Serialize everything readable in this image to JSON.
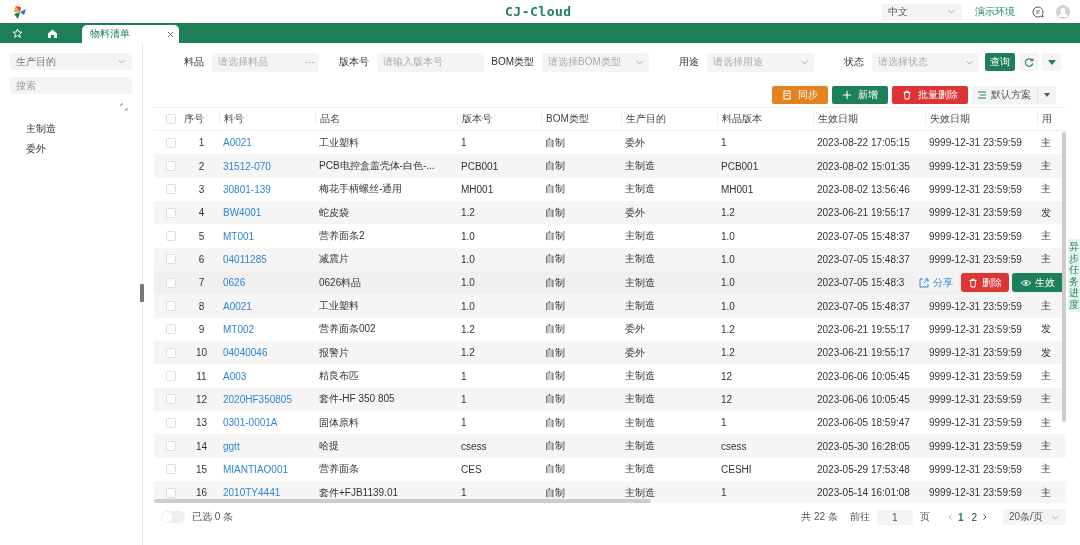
{
  "header": {
    "logo_text": "CJ-Cloud",
    "language": "中文",
    "environment": "演示环境"
  },
  "tabs": [
    {
      "label": "物料清单",
      "selected": true,
      "closable": true
    }
  ],
  "sidebar": {
    "purpose_select": {
      "placeholder": "生产目的"
    },
    "search": {
      "placeholder": "搜索"
    },
    "tree": [
      {
        "label": "主制造"
      },
      {
        "label": "委外"
      }
    ]
  },
  "filters": [
    {
      "label": "料品",
      "kind": "picker",
      "placeholder": "请选择料品"
    },
    {
      "label": "版本号",
      "kind": "input",
      "placeholder": "请输入版本号"
    },
    {
      "label": "BOM类型",
      "kind": "select",
      "placeholder": "请选择BOM类型"
    },
    {
      "label": "用途",
      "kind": "select",
      "placeholder": "请选择用途"
    },
    {
      "label": "状态",
      "kind": "select",
      "placeholder": "请选择状态"
    }
  ],
  "query_button": "查询",
  "toolbar": [
    {
      "label": "同步",
      "kind": "sync"
    },
    {
      "label": "新增",
      "kind": "add"
    },
    {
      "label": "批量删除",
      "kind": "delete"
    }
  ],
  "scheme": {
    "label": "默认方案"
  },
  "table": {
    "header_checked": false,
    "columns": [
      {
        "label": "序号",
        "kind": "index"
      },
      {
        "label": "料号",
        "kind": "link"
      },
      {
        "label": "品名",
        "kind": "text"
      },
      {
        "label": "版本号",
        "kind": "text"
      },
      {
        "label": "BOM类型",
        "kind": "text"
      },
      {
        "label": "生产目的",
        "kind": "text"
      },
      {
        "label": "料品版本",
        "kind": "text"
      },
      {
        "label": "生效日期",
        "kind": "text"
      },
      {
        "label": "失效日期",
        "kind": "text"
      },
      {
        "label": "用",
        "kind": "text"
      }
    ],
    "rows": [
      {
        "checked": false,
        "hovered": false,
        "cells": [
          "1",
          "A0021",
          "工业塑料",
          "1",
          "自制",
          "委外",
          "1",
          "2023-08-22 17:05:15",
          "9999-12-31 23:59:59",
          "主"
        ]
      },
      {
        "checked": false,
        "hovered": false,
        "cells": [
          "2",
          "31512-070",
          "PCB电控盒盖壳体-白色-...",
          "PCB001",
          "自制",
          "主制造",
          "PCB001",
          "2023-08-02 15:01:35",
          "9999-12-31 23:59:59",
          "主"
        ]
      },
      {
        "checked": false,
        "hovered": false,
        "cells": [
          "3",
          "30801-139",
          "梅花手柄螺丝-通用",
          "MH001",
          "自制",
          "主制造",
          "MH001",
          "2023-08-02 13:56:46",
          "9999-12-31 23:59:59",
          "主"
        ]
      },
      {
        "checked": false,
        "hovered": false,
        "cells": [
          "4",
          "BW4001",
          "蛇皮袋",
          "1.2",
          "自制",
          "委外",
          "1.2",
          "2023-06-21 19:55:17",
          "9999-12-31 23:59:59",
          "发"
        ]
      },
      {
        "checked": false,
        "hovered": false,
        "cells": [
          "5",
          "MT001",
          "营养面条2",
          "1.0",
          "自制",
          "主制造",
          "1.0",
          "2023-07-05 15:48:37",
          "9999-12-31 23:59:59",
          "主"
        ]
      },
      {
        "checked": false,
        "hovered": false,
        "cells": [
          "6",
          "04011285",
          "减震片",
          "1.0",
          "自制",
          "主制造",
          "1.0",
          "2023-07-05 15:48:37",
          "9999-12-31 23:59:59",
          "主"
        ]
      },
      {
        "checked": false,
        "hovered": true,
        "cells": [
          "7",
          "0626",
          "0626料品",
          "1.0",
          "自制",
          "主制造",
          "1.0",
          "2023-07-05 15:48:3"
        ]
      },
      {
        "checked": false,
        "hovered": false,
        "cells": [
          "8",
          "A0021",
          "工业塑料",
          "1.0",
          "自制",
          "主制造",
          "1.0",
          "2023-07-05 15:48:37",
          "9999-12-31 23:59:59",
          "主"
        ]
      },
      {
        "checked": false,
        "hovered": false,
        "cells": [
          "9",
          "MT002",
          "营养面条002",
          "1.2",
          "自制",
          "委外",
          "1.2",
          "2023-06-21 19:55:17",
          "9999-12-31 23:59:59",
          "发"
        ]
      },
      {
        "checked": false,
        "hovered": false,
        "cells": [
          "10",
          "04040046",
          "报警片",
          "1.2",
          "自制",
          "委外",
          "1.2",
          "2023-06-21 19:55:17",
          "9999-12-31 23:59:59",
          "发"
        ]
      },
      {
        "checked": false,
        "hovered": false,
        "cells": [
          "11",
          "A003",
          "精良布匹",
          "1",
          "自制",
          "主制造",
          "12",
          "2023-06-06 10:05:45",
          "9999-12-31 23:59:59",
          "主"
        ]
      },
      {
        "checked": false,
        "hovered": false,
        "cells": [
          "12",
          "2020HF350805",
          "套件-HF 350 805",
          "1",
          "自制",
          "主制造",
          "12",
          "2023-06-06 10:05:45",
          "9999-12-31 23:59:59",
          "主"
        ]
      },
      {
        "checked": false,
        "hovered": false,
        "cells": [
          "13",
          "0301-0001A",
          "固体原料",
          "1",
          "自制",
          "主制造",
          "1",
          "2023-06-05 18:59:47",
          "9999-12-31 23:59:59",
          "主"
        ]
      },
      {
        "checked": false,
        "hovered": false,
        "cells": [
          "14",
          "ggtt",
          "哈提",
          "csess",
          "自制",
          "主制造",
          "csess",
          "2023-05-30 16:28:05",
          "9999-12-31 23:59:59",
          "主"
        ]
      },
      {
        "checked": false,
        "hovered": false,
        "cells": [
          "15",
          "MIANTIAO001",
          "营养面条",
          "CES",
          "自制",
          "主制造",
          "CESHI",
          "2023-05-29 17:53:48",
          "9999-12-31 23:59:59",
          "主"
        ]
      },
      {
        "checked": false,
        "hovered": false,
        "cells": [
          "16",
          "2010TY4441",
          "套件+FJB1139.01",
          "1",
          "自制",
          "主制造",
          "1",
          "2023-05-14 16:01:08",
          "9999-12-31 23:59:59",
          "主"
        ]
      }
    ],
    "row_actions": [
      {
        "label": "分享",
        "kind": "share"
      },
      {
        "label": "删除",
        "kind": "delete"
      },
      {
        "label": "生效",
        "kind": "activate"
      }
    ]
  },
  "side_tab": "异步任务进度",
  "footer": {
    "select_all_on": false,
    "selected_text": "已选 0 条",
    "total": "共 22 条",
    "goto_label": "前往",
    "page_input": "1",
    "page_unit": "页",
    "pages": [
      {
        "label": "1",
        "selected": true
      },
      {
        "label": "2",
        "selected": false
      }
    ],
    "page_size": "20条/页"
  }
}
